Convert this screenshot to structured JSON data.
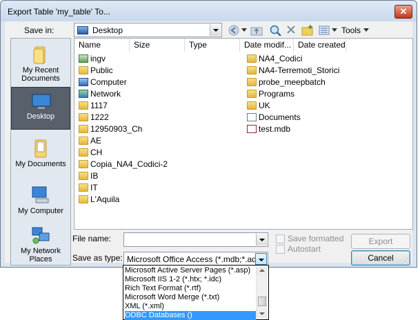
{
  "window": {
    "title": "Export Table 'my_table' To...",
    "close_glyph": "✕"
  },
  "save_in": {
    "label": "Save in:",
    "value": "Desktop"
  },
  "toolbar": {
    "tools_label": "Tools"
  },
  "places": [
    {
      "label": "My Recent Documents",
      "icon": "recent-documents-icon"
    },
    {
      "label": "Desktop",
      "icon": "desktop-icon",
      "selected": true
    },
    {
      "label": "My Documents",
      "icon": "my-documents-icon"
    },
    {
      "label": "My Computer",
      "icon": "my-computer-icon"
    },
    {
      "label": "My Network Places",
      "icon": "network-places-icon"
    }
  ],
  "columns": [
    "Name",
    "Size",
    "Type",
    "Date modif...",
    "Date created"
  ],
  "files_left": [
    {
      "name": "ingv",
      "icon": "green"
    },
    {
      "name": "Public",
      "icon": "folder"
    },
    {
      "name": "Computer",
      "icon": "pc"
    },
    {
      "name": "Network",
      "icon": "net"
    },
    {
      "name": "1117",
      "icon": "folder"
    },
    {
      "name": "1222",
      "icon": "folder"
    },
    {
      "name": "12950903_Ch",
      "icon": "folder"
    },
    {
      "name": "AE",
      "icon": "folder"
    },
    {
      "name": "CH",
      "icon": "folder"
    },
    {
      "name": "Copia_NA4_Codici-2",
      "icon": "folder"
    },
    {
      "name": "IB",
      "icon": "folder"
    },
    {
      "name": "IT",
      "icon": "folder"
    },
    {
      "name": "L'Aquila",
      "icon": "folder"
    }
  ],
  "files_right": [
    {
      "name": "NA4_Codici",
      "icon": "folder"
    },
    {
      "name": "NA4-Terremoti_Storici",
      "icon": "folder"
    },
    {
      "name": "probe_meepbatch",
      "icon": "folder"
    },
    {
      "name": "Programs",
      "icon": "folder"
    },
    {
      "name": "UK",
      "icon": "folder"
    },
    {
      "name": "Documents",
      "icon": "doc"
    },
    {
      "name": "test.mdb",
      "icon": "mdb"
    }
  ],
  "file_name": {
    "label": "File name:",
    "value": ""
  },
  "save_as_type": {
    "label": "Save as type:",
    "value": "Microsoft Office Access (*.mdb;*.adp;*"
  },
  "checkboxes": {
    "save_formatted": "Save formatted",
    "autostart": "Autostart"
  },
  "buttons": {
    "export": "Export",
    "cancel": "Cancel"
  },
  "type_options": [
    "Microsoft Active Server Pages (*.asp)",
    "Microsoft IIS 1-2 (*.htx; *.idc)",
    "Rich Text Format (*.rtf)",
    "Microsoft Word Merge (*.txt)",
    "XML (*.xml)",
    "ODBC Databases ()"
  ],
  "type_selected_index": 5
}
